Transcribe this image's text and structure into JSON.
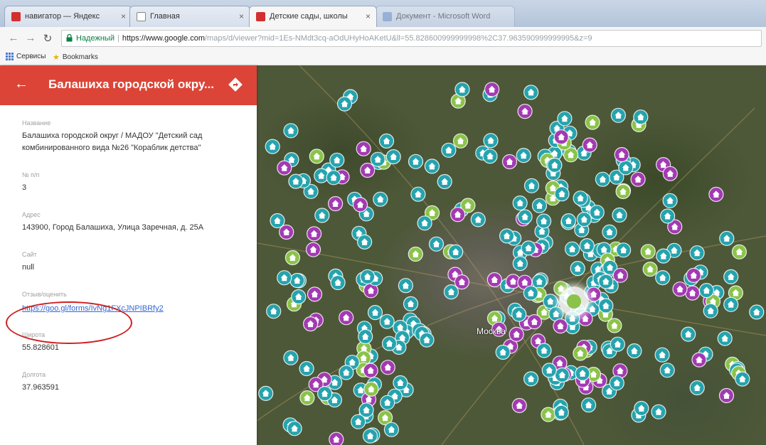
{
  "browser": {
    "tabs": [
      {
        "title": "навигатор — Яндекс",
        "icon": "yandex-favicon",
        "color": "#d32f2f"
      },
      {
        "title": "Главная",
        "icon": "document-favicon",
        "color": "#ffffff"
      },
      {
        "title": "Детские сады, школы",
        "icon": "google-maps-favicon",
        "color": "#d32f2f"
      },
      {
        "title": "Документ - Microsoft Word",
        "icon": "word-favicon",
        "color": "#7b9bd1"
      }
    ],
    "close_glyph": "×",
    "address": {
      "secure_label": "Надежный",
      "separator": "|",
      "host": "https://www.google.com",
      "path": "/maps/d/viewer?mid=1Es-NMdt3cq-aOdUHyHoAKetU&ll=55.828600999999998%2C37.963590999999995&z=9"
    },
    "bookmarks": [
      {
        "label": "Сервисы",
        "icon": "apps-grid-icon"
      },
      {
        "label": "Bookmarks",
        "icon": "star-icon"
      }
    ]
  },
  "panel": {
    "title": "Балашиха городской окру...",
    "header_color": "#db4437",
    "fields": [
      {
        "label": "Название",
        "value": "Балашиха городской округ / МАДОУ \"Детский сад комбинированного вида №26 \"Кораблик детства\""
      },
      {
        "label": "№ п/п",
        "value": "3"
      },
      {
        "label": "Адрес",
        "value": "143900, Город Балашиха, Улица Заречная, д. 25А"
      },
      {
        "label": "Сайт",
        "value": "null"
      },
      {
        "label": "Отзыв/оценить",
        "value": "https://goo.gl/forms/IvNg1FXcJNPIBRfy2",
        "link": true
      },
      {
        "label": "Широта",
        "value": "55.828601"
      },
      {
        "label": "Долгота",
        "value": "37.963591"
      }
    ]
  },
  "map": {
    "city_label": "Москва",
    "marker_colors": {
      "teal": "#26a3ad",
      "purple": "#a33ab2",
      "green": "#8bc34a"
    }
  }
}
